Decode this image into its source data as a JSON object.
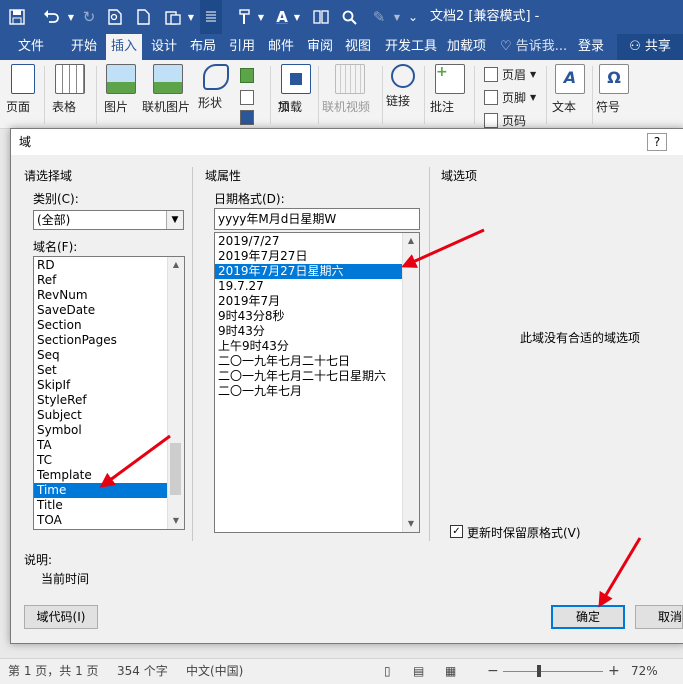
{
  "app": {
    "doc_title": "文档2 [兼容模式] -"
  },
  "tabs": [
    {
      "label": "文件"
    },
    {
      "label": "开始"
    },
    {
      "label": "插入"
    },
    {
      "label": "设计"
    },
    {
      "label": "布局"
    },
    {
      "label": "引用"
    },
    {
      "label": "邮件"
    },
    {
      "label": "审阅"
    },
    {
      "label": "视图"
    },
    {
      "label": "开发工具"
    },
    {
      "label": "加载项"
    }
  ],
  "header": {
    "tell_me": "告诉我...",
    "signin": "登录",
    "share": "共享"
  },
  "ribbon": {
    "page": "页面",
    "table": "表格",
    "picture": "图片",
    "online_picture": "联机图片",
    "shapes": "形状",
    "addins": "加载",
    "addins2": "项",
    "online_video": "联机视频",
    "link": "链接",
    "comment": "批注",
    "header": "页眉",
    "footer": "页脚",
    "page_number": "页码",
    "text": "文本",
    "symbol": "符号"
  },
  "dialog": {
    "title": "域",
    "help": "?",
    "choose_field": "请选择域",
    "category_label": "类别(C):",
    "category_value": "(全部)",
    "field_names_label": "域名(F):",
    "field_names": [
      "RD",
      "Ref",
      "RevNum",
      "SaveDate",
      "Section",
      "SectionPages",
      "Seq",
      "Set",
      "SkipIf",
      "StyleRef",
      "Subject",
      "Symbol",
      "TA",
      "TC",
      "Template",
      "Time",
      "Title",
      "TOA"
    ],
    "field_properties": "域属性",
    "date_format_label": "日期格式(D):",
    "date_format_value": "yyyy年M月d日星期W",
    "date_formats": [
      "2019/7/27",
      "2019年7月27日",
      "2019年7月27日星期六",
      "19.7.27",
      "2019年7月",
      "9时43分8秒",
      "9时43分",
      "上午9时43分",
      "二〇一九年七月二十七日",
      "二〇一九年七月二十七日星期六",
      "二〇一九年七月"
    ],
    "field_options": "域选项",
    "no_options": "此域没有合适的域选项",
    "preserve_format": "更新时保留原格式(V)",
    "description_label": "说明:",
    "description": "当前时间",
    "field_codes_btn": "域代码(I)",
    "ok_btn": "确定",
    "cancel_btn": "取消"
  },
  "status": {
    "page": "第 1 页，共 1 页",
    "words": "354 个字",
    "lang": "中文(中国)",
    "zoom": "72%"
  }
}
